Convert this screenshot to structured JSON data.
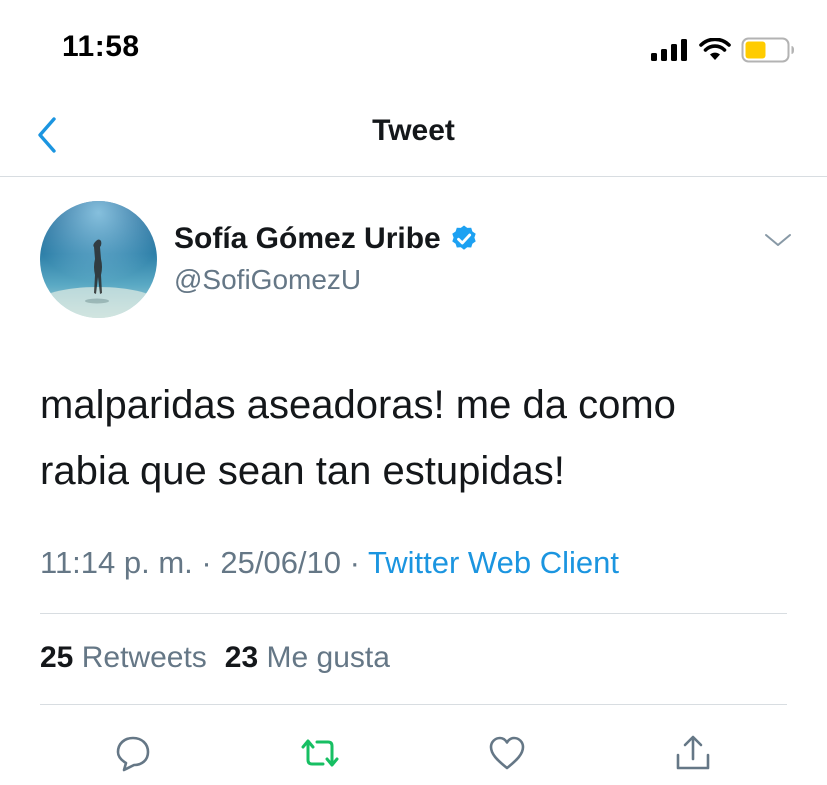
{
  "status_bar": {
    "time": "11:58"
  },
  "nav": {
    "title": "Tweet"
  },
  "tweet": {
    "author": {
      "name": "Sofía Gómez Uribe",
      "handle": "@SofiGomezU",
      "verified": true
    },
    "text_line_1": "malparidas aseadoras! me da como",
    "text_line_2": "rabia que sean tan estupidas!",
    "time": "11:14 p. m.",
    "separator": " · ",
    "date": "25/06/10",
    "source": "Twitter Web Client",
    "stats": {
      "retweets_count": "25",
      "retweets_label": "Retweets",
      "likes_count": "23",
      "likes_label": "Me gusta"
    }
  },
  "icons": {
    "back": "chevron-left-icon",
    "more": "chevron-down-icon",
    "verified": "verified-badge-icon",
    "reply": "reply-icon",
    "retweet": "retweet-icon",
    "like": "heart-icon",
    "share": "share-icon"
  },
  "colors": {
    "accent": "#1b95e0",
    "retweet_active": "#17bf63",
    "secondary_text": "#657786",
    "primary_text": "#14171a",
    "battery": "#ffcc00"
  }
}
